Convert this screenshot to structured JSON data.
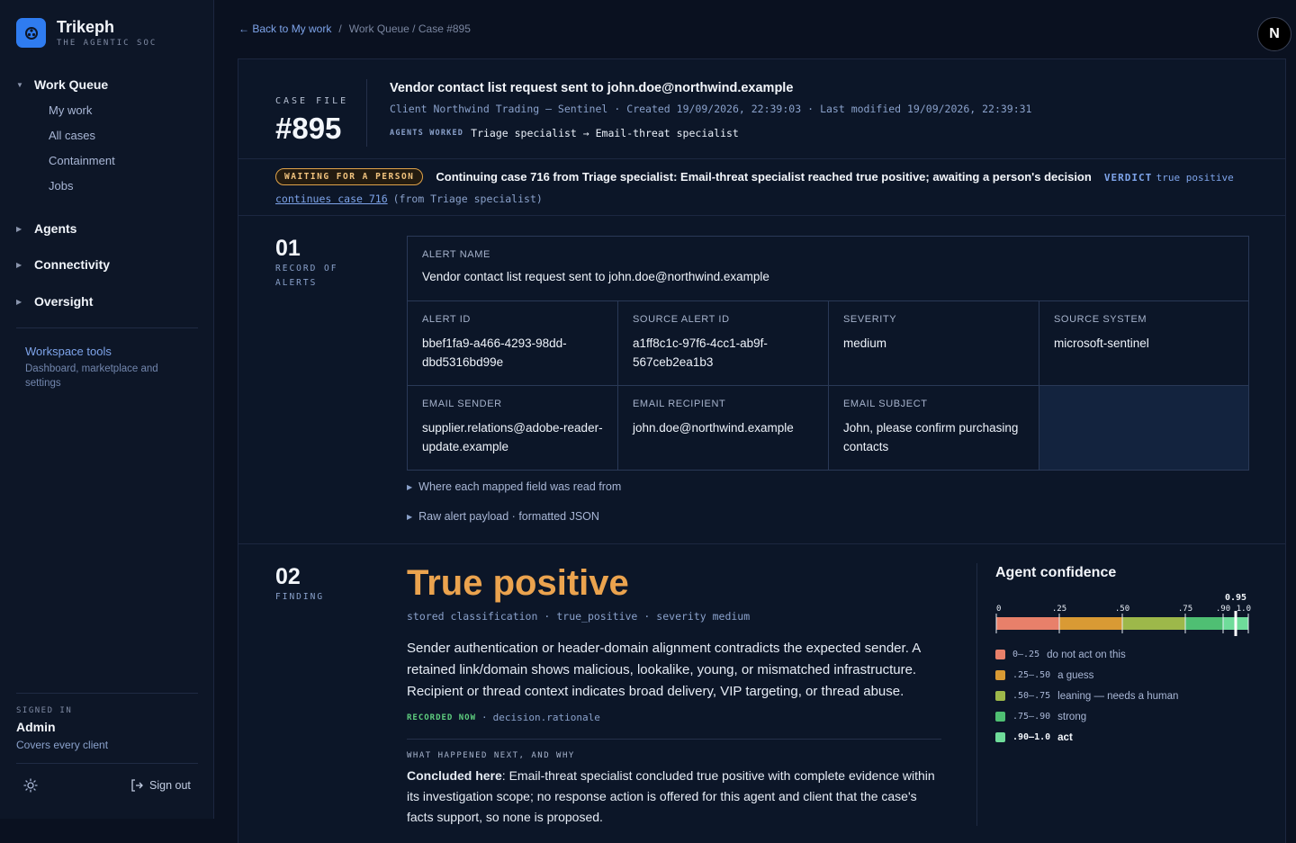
{
  "brand": {
    "name": "Trikeph",
    "tagline": "THE AGENTIC SOC"
  },
  "nav": {
    "work_queue": {
      "label": "Work Queue",
      "items": [
        "My work",
        "All cases",
        "Containment",
        "Jobs"
      ]
    },
    "agents": "Agents",
    "connectivity": "Connectivity",
    "oversight": "Oversight"
  },
  "workspace": {
    "title": "Workspace tools",
    "desc": "Dashboard, marketplace and settings"
  },
  "user": {
    "signed_label": "SIGNED IN",
    "name": "Admin",
    "scope": "Covers every client",
    "signout": "Sign out",
    "avatar_letter": "N"
  },
  "breadcrumb": {
    "back": "← Back to My work",
    "sep": "/",
    "path": "Work Queue / Case #895"
  },
  "case": {
    "file_label": "CASE FILE",
    "number": "#895",
    "title": "Vendor contact list request sent to john.doe@northwind.example",
    "client": "Client Northwind Trading — Sentinel",
    "dot": "·",
    "created": "Created 19/09/2026, 22:39:03",
    "modified": "Last modified 19/09/2026, 22:39:31",
    "agents_label": "AGENTS WORKED",
    "agents_value": "Triage specialist → Email-threat specialist"
  },
  "status": {
    "pill": "WAITING FOR A PERSON",
    "text": "Continuing case 716 from Triage specialist: Email-threat specialist reached true positive; awaiting a person's decision",
    "verdict_label": "VERDICT",
    "verdict_value": "true positive",
    "continues_link": "continues case 716",
    "continues_from": "(from Triage specialist)"
  },
  "section1": {
    "num": "01",
    "label": "RECORD OF ALERTS",
    "alert_name_label": "ALERT NAME",
    "alert_name": "Vendor contact list request sent to john.doe@northwind.example",
    "fields": [
      {
        "label": "ALERT ID",
        "value": "bbef1fa9-a466-4293-98dd-dbd5316bd99e"
      },
      {
        "label": "SOURCE ALERT ID",
        "value": "a1ff8c1c-97f6-4cc1-ab9f-567ceb2ea1b3"
      },
      {
        "label": "SEVERITY",
        "value": "medium"
      },
      {
        "label": "SOURCE SYSTEM",
        "value": "microsoft-sentinel"
      },
      {
        "label": "EMAIL SENDER",
        "value": "supplier.relations@adobe-reader-update.example"
      },
      {
        "label": "EMAIL RECIPIENT",
        "value": "john.doe@northwind.example"
      },
      {
        "label": "EMAIL SUBJECT",
        "value": "John, please confirm purchasing contacts"
      }
    ],
    "disclosure_fields": "Where each mapped field was read from",
    "disclosure_payload": "Raw alert payload · formatted JSON"
  },
  "section2": {
    "num": "02",
    "label": "FINDING",
    "title": "True positive",
    "meta_a": "stored classification",
    "meta_b": "true_positive",
    "meta_c": "severity medium",
    "rationale": "Sender authentication or header-domain alignment contradicts the expected sender. A retained link/domain shows malicious, lookalike, young, or mismatched infrastructure. Recipient or thread context indicates broad delivery, VIP targeting, or thread abuse.",
    "recorded_tag": "RECORDED NOW",
    "recorded_src": "decision.rationale",
    "next_label": "WHAT HAPPENED NEXT, AND WHY",
    "next_bold": "Concluded here",
    "next_text": ": Email-threat specialist concluded true positive with complete evidence within its investigation scope; no response action is offered for this agent and client that the case's facts support, so none is proposed."
  },
  "confidence": {
    "title": "Agent confidence",
    "value": 0.95,
    "value_label": "0.95",
    "ticks": [
      {
        "v": 0,
        "label": "0"
      },
      {
        "v": 0.25,
        "label": ".25"
      },
      {
        "v": 0.5,
        "label": ".50"
      },
      {
        "v": 0.75,
        "label": ".75"
      },
      {
        "v": 0.9,
        "label": ".90"
      },
      {
        "v": 1.0,
        "label": "1.0"
      }
    ],
    "bands": [
      {
        "from": 0,
        "to": 0.25,
        "color": "#e8806a",
        "range": "0–.25",
        "text": "do not act on this"
      },
      {
        "from": 0.25,
        "to": 0.5,
        "color": "#d99a34",
        "range": ".25–.50",
        "text": "a guess"
      },
      {
        "from": 0.5,
        "to": 0.75,
        "color": "#9db84a",
        "range": ".50–.75",
        "text": "leaning — needs a human"
      },
      {
        "from": 0.75,
        "to": 0.9,
        "color": "#4fbf73",
        "range": ".75–.90",
        "text": "strong"
      },
      {
        "from": 0.9,
        "to": 1.0,
        "color": "#6fdc9a",
        "range": ".90–1.0",
        "text": "act"
      }
    ]
  },
  "colors": {
    "accent": "#7ea4ea",
    "finding": "#eba34e",
    "pill": "#e0a34a",
    "brand": "#2f7cf0"
  }
}
